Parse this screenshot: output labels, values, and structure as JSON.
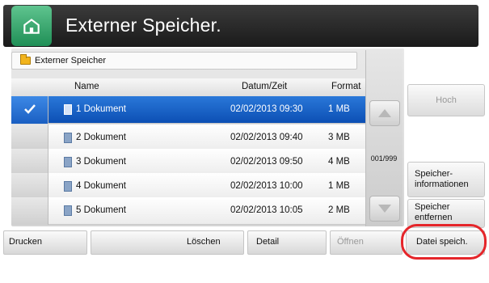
{
  "window": {
    "title": "Externer Speicher."
  },
  "path": {
    "label": "Externer Speicher"
  },
  "table": {
    "headers": {
      "name": "Name",
      "date": "Datum/Zeit",
      "format": "Format"
    },
    "rows": [
      {
        "name": "1  Dokument",
        "date": "02/02/2013 09:30",
        "format": "1  MB",
        "selected": true
      },
      {
        "name": "2  Dokument",
        "date": "02/02/2013 09:40",
        "format": "3  MB",
        "selected": false
      },
      {
        "name": "3  Dokument",
        "date": "02/02/2013 09:50",
        "format": "4  MB",
        "selected": false
      },
      {
        "name": "4  Dokument",
        "date": "02/02/2013 10:00",
        "format": "1  MB",
        "selected": false
      },
      {
        "name": "5  Dokument",
        "date": "02/02/2013 10:05",
        "format": "2  MB",
        "selected": false
      }
    ]
  },
  "pager": {
    "text": "001/999"
  },
  "side": {
    "hoch": "Hoch",
    "info_line1": "Speicher-",
    "info_line2": "informationen",
    "remove_line1": "Speicher",
    "remove_line2": "entfernen"
  },
  "bottom": {
    "print": "Drucken",
    "delete": "Löschen",
    "detail": "Detail",
    "open": "Öffnen",
    "save": "Datei speich."
  },
  "colors": {
    "selection": "#1a63c8",
    "highlight_ring": "#e5252a",
    "home_button": "#2fa865"
  },
  "icons": {
    "home": "home-icon",
    "folder": "folder-icon",
    "document": "document-icon",
    "up": "arrow-up-icon",
    "down": "arrow-down-icon"
  }
}
